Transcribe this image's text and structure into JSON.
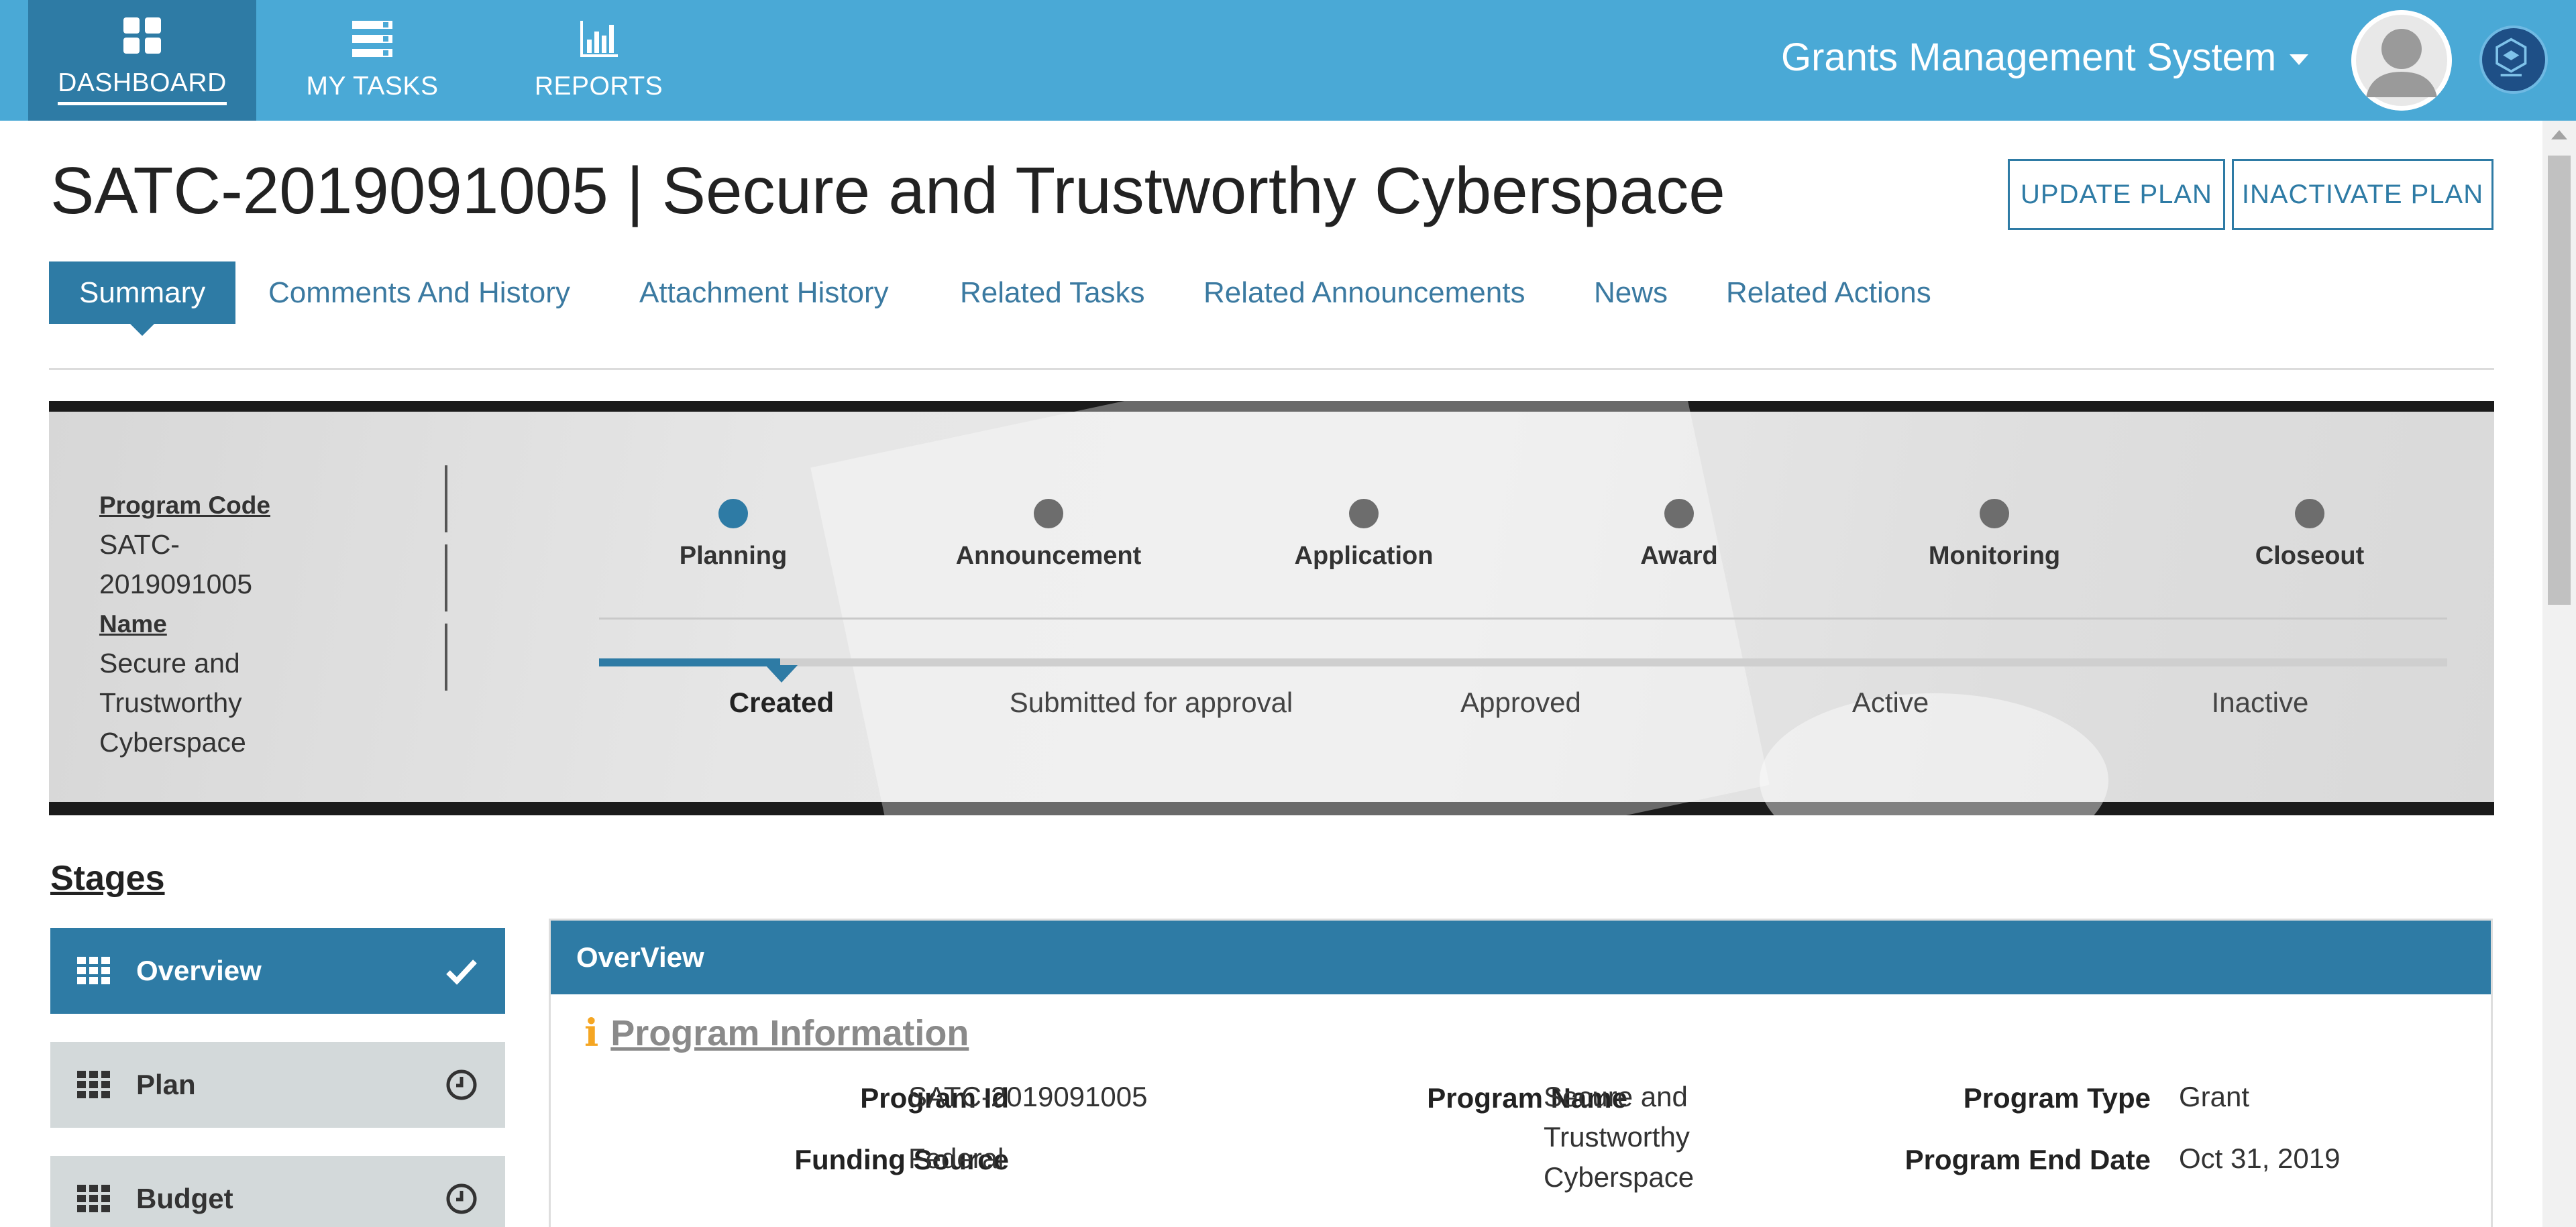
{
  "nav": {
    "items": [
      {
        "label": "DASHBOARD",
        "icon": "dashboard-icon",
        "active": true
      },
      {
        "label": "MY TASKS",
        "icon": "tasks-list-icon",
        "active": false
      },
      {
        "label": "REPORTS",
        "icon": "bar-chart-icon",
        "active": false
      }
    ],
    "system_title": "Grants Management System"
  },
  "page": {
    "title": "SATC-2019091005 | Secure and Trustworthy Cyberspace",
    "buttons": {
      "update": "UPDATE PLAN",
      "inactivate": "INACTIVATE PLAN"
    }
  },
  "tabs": [
    {
      "label": "Summary",
      "active": true
    },
    {
      "label": "Comments And History"
    },
    {
      "label": "Attachment History"
    },
    {
      "label": "Related Tasks"
    },
    {
      "label": "Related Announcements"
    },
    {
      "label": "News"
    },
    {
      "label": "Related Actions"
    }
  ],
  "banner": {
    "program_code_label": "Program Code",
    "program_code_value": "SATC-\n2019091005",
    "name_label": "Name",
    "name_value": "Secure and\nTrustworthy\nCyberspace",
    "stages": [
      "Planning",
      "Announcement",
      "Application",
      "Award",
      "Monitoring",
      "Closeout"
    ],
    "current_stage": "Planning",
    "statuses": [
      "Created",
      "Submitted for approval",
      "Approved",
      "Active",
      "Inactive"
    ],
    "current_status": "Created"
  },
  "sidebar": {
    "heading": "Stages",
    "items": [
      {
        "label": "Overview",
        "status": "complete",
        "active": true
      },
      {
        "label": "Plan",
        "status": "pending",
        "active": false
      },
      {
        "label": "Budget",
        "status": "pending",
        "active": false
      }
    ]
  },
  "overview": {
    "header": "OverView",
    "section_title": "Program Information",
    "fields": {
      "program_id_label": "Program Id",
      "program_id_value": "SATC-2019091005",
      "program_name_label": "Program Name",
      "program_name_value": "Secure and\nTrustworthy\nCyberspace",
      "program_type_label": "Program Type",
      "program_type_value": "Grant",
      "funding_source_label": "Funding Source",
      "funding_source_value": "Federal",
      "program_end_date_label": "Program End Date",
      "program_end_date_value": "Oct 31, 2019"
    }
  },
  "colors": {
    "topbar": "#4aa9d6",
    "primary": "#2e7ba5",
    "inactive_stage": "#d3d9da",
    "info_icon": "#f5a623"
  }
}
